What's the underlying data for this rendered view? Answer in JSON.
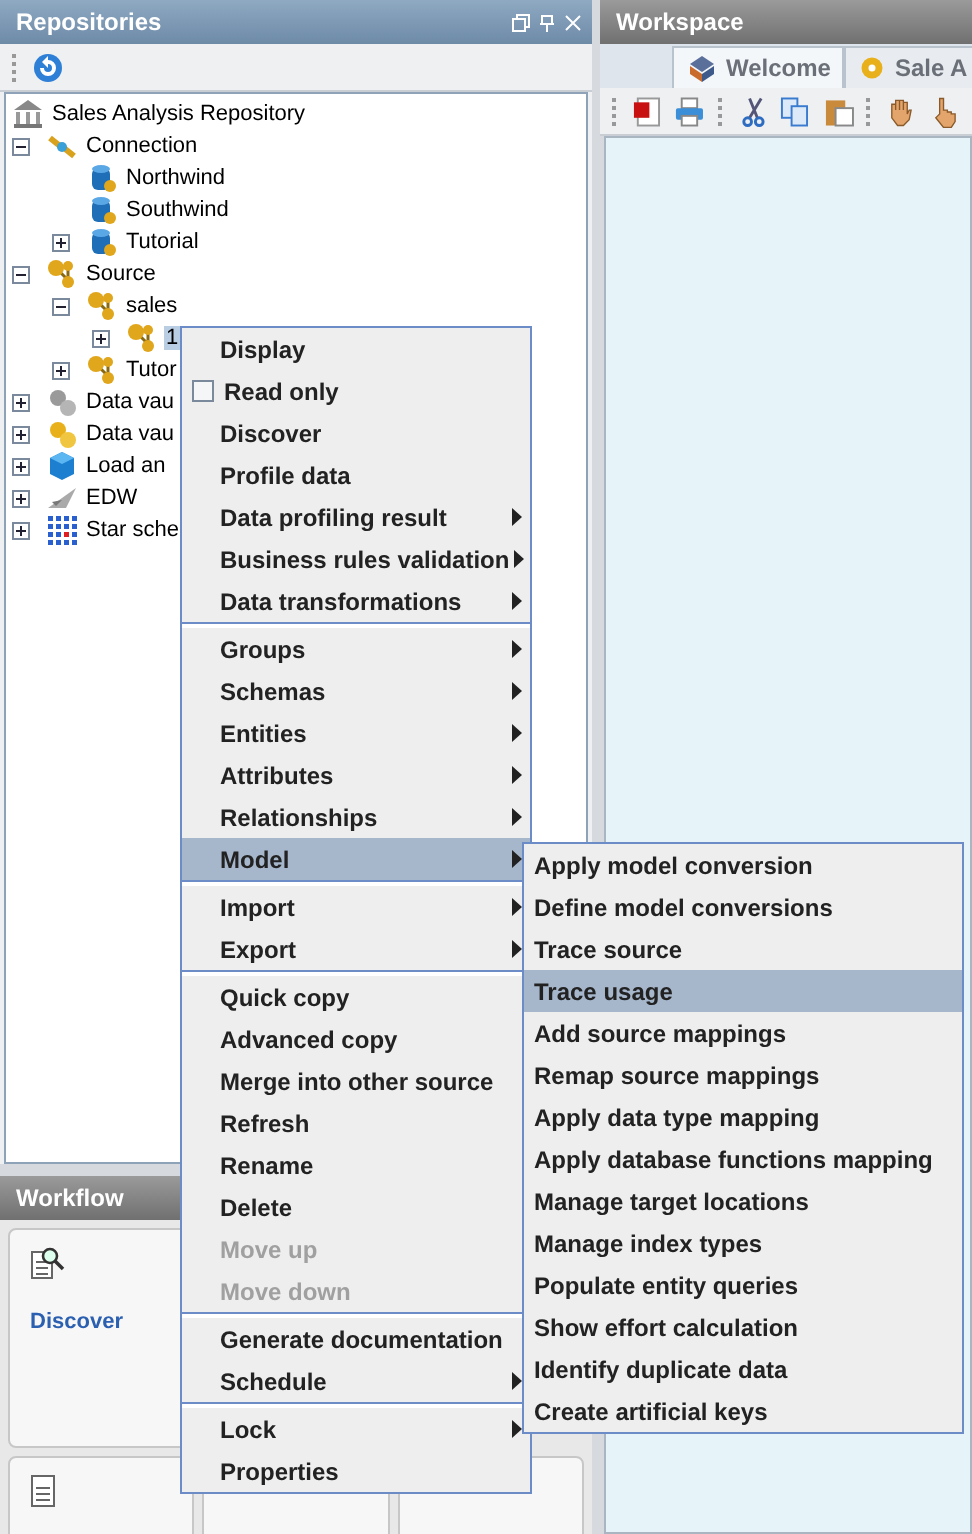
{
  "repositories": {
    "title": "Repositories",
    "tree": [
      {
        "label": "Sales Analysis Repository",
        "kind": "repository",
        "selected": false,
        "children": [
          {
            "label": "Connection",
            "kind": "connection",
            "expanded": true,
            "selected": false,
            "children": [
              {
                "label": "Northwind",
                "kind": "database",
                "selected": false
              },
              {
                "label": "Southwind",
                "kind": "database",
                "selected": false
              },
              {
                "label": "Tutorial",
                "kind": "database",
                "expanded": false,
                "selected": false
              }
            ]
          },
          {
            "label": "Source",
            "kind": "source",
            "expanded": true,
            "selected": false,
            "children": [
              {
                "label": "sales",
                "kind": "source",
                "expanded": true,
                "selected": false,
                "children": [
                  {
                    "label": "1",
                    "kind": "source",
                    "expanded": false,
                    "selected": true
                  }
                ]
              },
              {
                "label": "Tutor",
                "kind": "source",
                "expanded": false,
                "selected": false
              }
            ]
          },
          {
            "label": "Data vau",
            "kind": "vault-gray",
            "expanded": false,
            "selected": false
          },
          {
            "label": "Data vau",
            "kind": "vault-gold",
            "expanded": false,
            "selected": false
          },
          {
            "label": "Load an",
            "kind": "load",
            "expanded": false,
            "selected": false
          },
          {
            "label": "EDW",
            "kind": "edw",
            "expanded": false,
            "selected": false
          },
          {
            "label": "Star sche",
            "kind": "star",
            "expanded": false,
            "selected": false
          }
        ]
      }
    ]
  },
  "workflow": {
    "title": "Workflow",
    "cards": [
      {
        "label": "Discover",
        "kind": "discover"
      },
      {
        "kind": "document"
      },
      {
        "kind": "blank"
      },
      {
        "kind": "blank"
      }
    ]
  },
  "workspace": {
    "title": "Workspace",
    "tabs": [
      {
        "label": "Welcome",
        "kind": "welcome",
        "selected": true
      },
      {
        "label": "Sale A",
        "kind": "gear",
        "selected": false
      }
    ]
  },
  "context_menu": {
    "sections": [
      [
        {
          "label": "Display",
          "kind": "item",
          "submenu": false,
          "disabled": false,
          "selected": false
        },
        {
          "label": "Read only",
          "kind": "checkbox",
          "checked": false,
          "submenu": false,
          "disabled": false,
          "selected": false
        },
        {
          "label": "Discover",
          "kind": "item",
          "submenu": false,
          "disabled": false,
          "selected": false
        },
        {
          "label": "Profile data",
          "kind": "item",
          "submenu": false,
          "disabled": false,
          "selected": false
        },
        {
          "label": "Data profiling result",
          "kind": "item",
          "submenu": true,
          "disabled": false,
          "selected": false
        },
        {
          "label": "Business rules validation",
          "kind": "item",
          "submenu": true,
          "disabled": false,
          "selected": false
        },
        {
          "label": "Data transformations",
          "kind": "item",
          "submenu": true,
          "disabled": false,
          "selected": false
        }
      ],
      [
        {
          "label": "Groups",
          "kind": "item",
          "submenu": true,
          "disabled": false,
          "selected": false
        },
        {
          "label": "Schemas",
          "kind": "item",
          "submenu": true,
          "disabled": false,
          "selected": false
        },
        {
          "label": "Entities",
          "kind": "item",
          "submenu": true,
          "disabled": false,
          "selected": false
        },
        {
          "label": "Attributes",
          "kind": "item",
          "submenu": true,
          "disabled": false,
          "selected": false
        },
        {
          "label": "Relationships",
          "kind": "item",
          "submenu": true,
          "disabled": false,
          "selected": false
        },
        {
          "label": "Model",
          "kind": "item",
          "submenu": true,
          "disabled": false,
          "selected": true
        }
      ],
      [
        {
          "label": "Import",
          "kind": "item",
          "submenu": true,
          "disabled": false,
          "selected": false
        },
        {
          "label": "Export",
          "kind": "item",
          "submenu": true,
          "disabled": false,
          "selected": false
        }
      ],
      [
        {
          "label": "Quick copy",
          "kind": "item",
          "submenu": false,
          "disabled": false,
          "selected": false
        },
        {
          "label": "Advanced copy",
          "kind": "item",
          "submenu": false,
          "disabled": false,
          "selected": false
        },
        {
          "label": "Merge into other source",
          "kind": "item",
          "submenu": false,
          "disabled": false,
          "selected": false
        },
        {
          "label": "Refresh",
          "kind": "item",
          "submenu": false,
          "disabled": false,
          "selected": false
        },
        {
          "label": "Rename",
          "kind": "item",
          "submenu": false,
          "disabled": false,
          "selected": false
        },
        {
          "label": "Delete",
          "kind": "item",
          "submenu": false,
          "disabled": false,
          "selected": false
        },
        {
          "label": "Move up",
          "kind": "item",
          "submenu": false,
          "disabled": true,
          "selected": false
        },
        {
          "label": "Move down",
          "kind": "item",
          "submenu": false,
          "disabled": true,
          "selected": false
        }
      ],
      [
        {
          "label": "Generate documentation",
          "kind": "item",
          "submenu": false,
          "disabled": false,
          "selected": false
        },
        {
          "label": "Schedule",
          "kind": "item",
          "submenu": true,
          "disabled": false,
          "selected": false
        }
      ],
      [
        {
          "label": "Lock",
          "kind": "item",
          "submenu": true,
          "disabled": false,
          "selected": false
        },
        {
          "label": "Properties",
          "kind": "item",
          "submenu": false,
          "disabled": false,
          "selected": false
        }
      ]
    ]
  },
  "model_submenu": {
    "items": [
      {
        "label": "Apply model conversion",
        "selected": false
      },
      {
        "label": "Define model conversions",
        "selected": false
      },
      {
        "label": "Trace source",
        "selected": false
      },
      {
        "label": "Trace usage",
        "selected": true
      },
      {
        "label": "Add source mappings",
        "selected": false
      },
      {
        "label": "Remap source mappings",
        "selected": false
      },
      {
        "label": "Apply data type mapping",
        "selected": false
      },
      {
        "label": "Apply database functions mapping",
        "selected": false
      },
      {
        "label": "Manage target locations",
        "selected": false
      },
      {
        "label": "Manage index types",
        "selected": false
      },
      {
        "label": "Populate entity queries",
        "selected": false
      },
      {
        "label": "Show effort calculation",
        "selected": false
      },
      {
        "label": "Identify duplicate data",
        "selected": false
      },
      {
        "label": "Create artificial keys",
        "selected": false
      }
    ]
  }
}
